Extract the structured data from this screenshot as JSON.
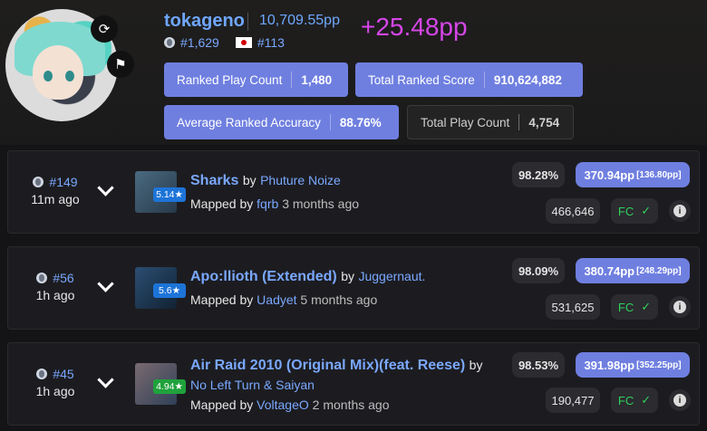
{
  "profile": {
    "username": "tokageno",
    "total_pp": "10,709.55pp",
    "pp_gain": "+25.48pp",
    "global_rank": "#1,629",
    "country_rank": "#113",
    "stats": [
      {
        "label": "Ranked Play Count",
        "value": "1,480"
      },
      {
        "label": "Total Ranked Score",
        "value": "910,624,882"
      },
      {
        "label": "Average Ranked Accuracy",
        "value": "88.76%"
      },
      {
        "label": "Total Play Count",
        "value": "4,754"
      }
    ]
  },
  "scores": [
    {
      "rank": "#149",
      "ago": "11m ago",
      "stars": "5.14★",
      "title": "Sharks",
      "by": "by",
      "artist": "Phuture Noize",
      "mapped_by": "Mapped by",
      "mapper": "fqrb",
      "mapped_when": "3 months ago",
      "accuracy": "98.28%",
      "pp": "370.94pp",
      "pp_sub": "[136.80pp]",
      "score": "466,646",
      "fc": "FC"
    },
    {
      "rank": "#56",
      "ago": "1h ago",
      "stars": "5.6★",
      "title": "Apo:llioth (Extended)",
      "by": "by",
      "artist": "Juggernaut.",
      "mapped_by": "Mapped by",
      "mapper": "Uadyet",
      "mapped_when": "5 months ago",
      "accuracy": "98.09%",
      "pp": "380.74pp",
      "pp_sub": "[248.29pp]",
      "score": "531,625",
      "fc": "FC"
    },
    {
      "rank": "#45",
      "ago": "1h ago",
      "stars": "4.94★",
      "title": "Air Raid 2010 (Original Mix)(feat. Reese)",
      "by": "by",
      "artist": "No Left Turn & Saiyan",
      "mapped_by": "Mapped by",
      "mapper": "VoltageO",
      "mapped_when": "2 months ago",
      "accuracy": "98.53%",
      "pp": "391.98pp",
      "pp_sub": "[352.25pp]",
      "score": "190,477",
      "fc": "FC"
    }
  ],
  "icons": {
    "refresh": "refresh-icon",
    "flag": "flag-icon",
    "globe": "globe-icon",
    "country": "japan-flag-icon",
    "expand": "chevron-down-icon",
    "check": "check-icon",
    "info": "info-icon"
  },
  "colors": {
    "accent": "#6f7fe0",
    "link": "#7aa8ff",
    "pp_gain": "#d546e8",
    "fc": "#2fd05a"
  }
}
